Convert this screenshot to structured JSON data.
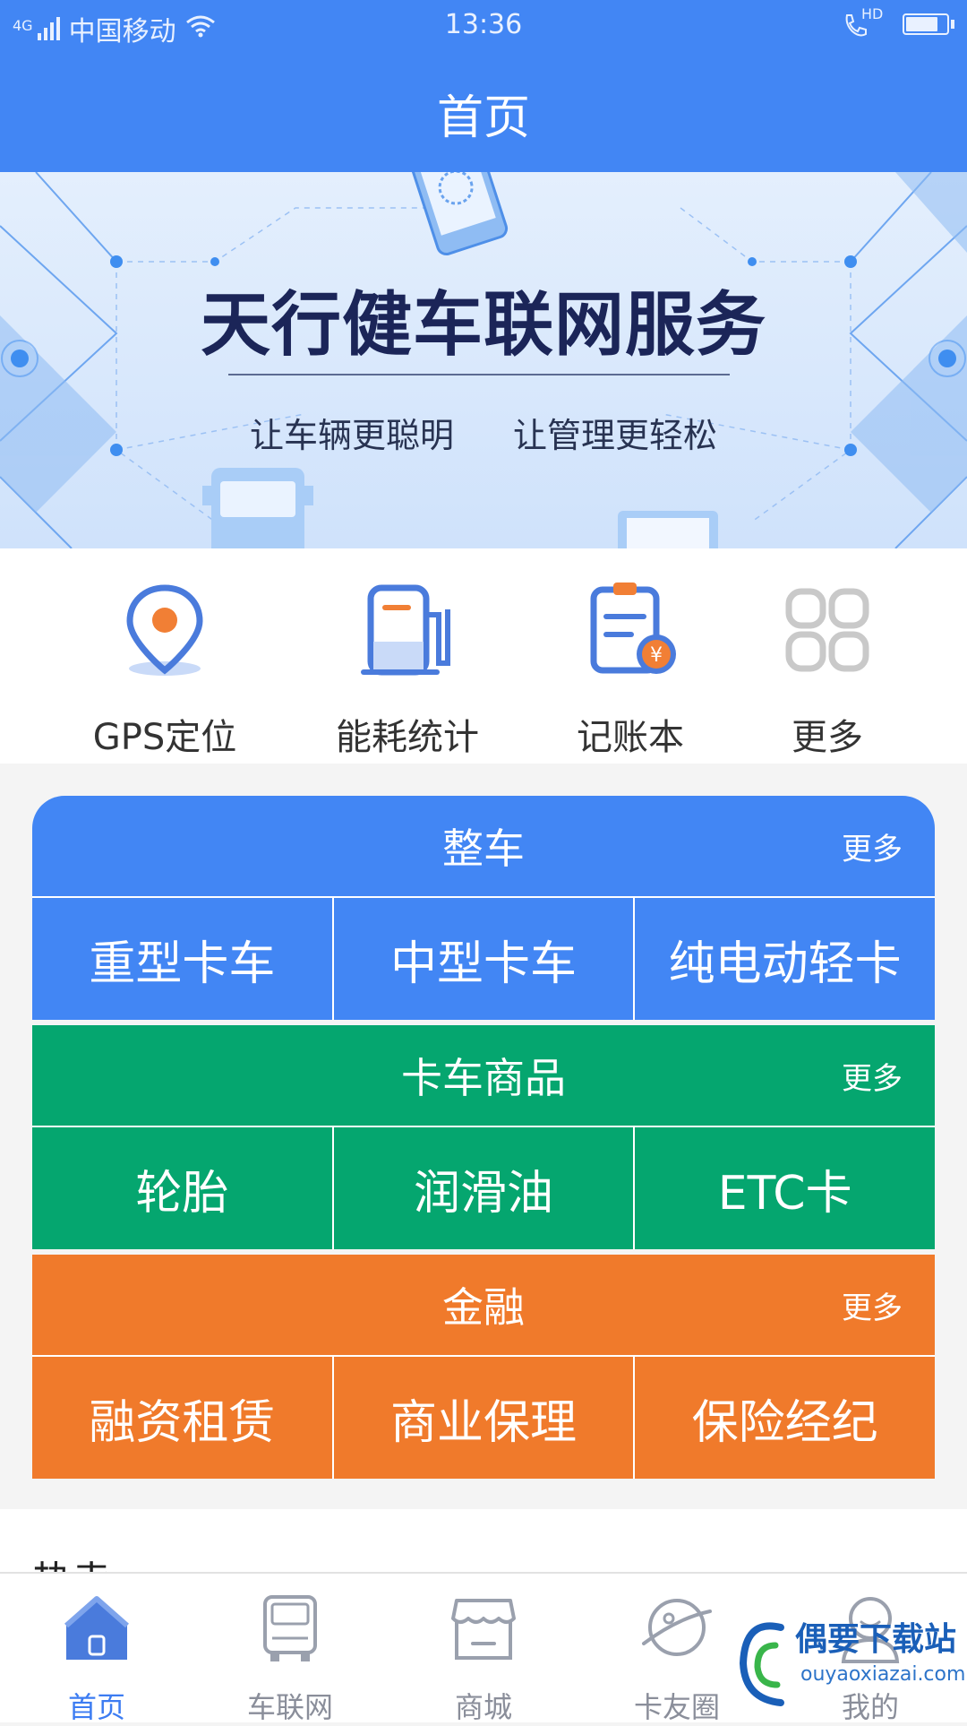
{
  "status_bar": {
    "network": "4G",
    "carrier": "中国移动",
    "time": "13:36",
    "hd": "HD"
  },
  "header": {
    "title": "首页"
  },
  "banner": {
    "title": "天行健车联网服务",
    "subtitle_left": "让车辆更聪明",
    "subtitle_right": "让管理更轻松"
  },
  "quick_actions": [
    {
      "label": "GPS定位",
      "icon": "location-pin-icon"
    },
    {
      "label": "能耗统计",
      "icon": "fuel-pump-icon"
    },
    {
      "label": "记账本",
      "icon": "ledger-icon"
    },
    {
      "label": "更多",
      "icon": "grid-more-icon"
    }
  ],
  "sections": [
    {
      "title": "整车",
      "more": "更多",
      "color": "#4286f4",
      "items": [
        "重型卡车",
        "中型卡车",
        "纯电动轻卡"
      ]
    },
    {
      "title": "卡车商品",
      "more": "更多",
      "color": "#05a66f",
      "items": [
        "轮胎",
        "润滑油",
        "ETC卡"
      ]
    },
    {
      "title": "金融",
      "more": "更多",
      "color": "#f07a2b",
      "items": [
        "融资租赁",
        "商业保理",
        "保险经纪"
      ]
    }
  ],
  "hot": {
    "title": "热卖"
  },
  "tabbar": [
    {
      "label": "首页",
      "icon": "home-icon",
      "active": true
    },
    {
      "label": "车联网",
      "icon": "truck-icon",
      "active": false
    },
    {
      "label": "商城",
      "icon": "shop-icon",
      "active": false
    },
    {
      "label": "卡友圈",
      "icon": "planet-icon",
      "active": false
    },
    {
      "label": "我的",
      "icon": "profile-icon",
      "active": false
    }
  ],
  "watermark": {
    "name": "偶要下载站",
    "url": "ouyaoxiazai.com"
  },
  "colors": {
    "primary": "#4286f4",
    "green": "#05a66f",
    "orange": "#f07a2b"
  }
}
